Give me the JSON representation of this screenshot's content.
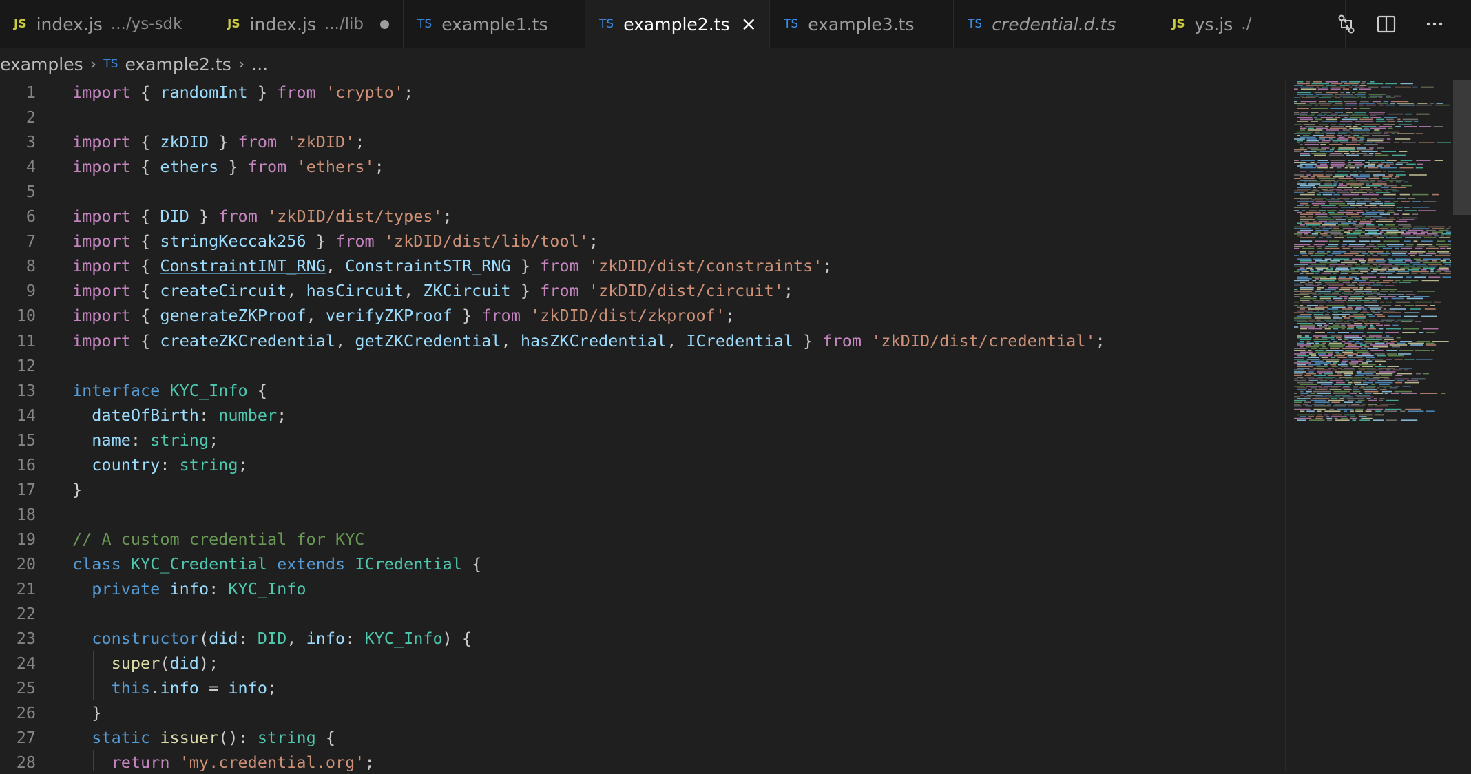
{
  "tabs": [
    {
      "type": "JS",
      "name": "index.js",
      "desc": ".../ys-sdk",
      "active": false,
      "italic": false,
      "modified": false
    },
    {
      "type": "JS",
      "name": "index.js",
      "desc": ".../lib",
      "active": false,
      "italic": false,
      "modified": true
    },
    {
      "type": "TS",
      "name": "example1.ts",
      "desc": "",
      "active": false,
      "italic": false,
      "modified": false
    },
    {
      "type": "TS",
      "name": "example2.ts",
      "desc": "",
      "active": true,
      "italic": false,
      "modified": false
    },
    {
      "type": "TS",
      "name": "example3.ts",
      "desc": "",
      "active": false,
      "italic": false,
      "modified": false
    },
    {
      "type": "TS",
      "name": "credential.d.ts",
      "desc": "",
      "active": false,
      "italic": true,
      "modified": false
    },
    {
      "type": "JS",
      "name": "ys.js",
      "desc": "./",
      "active": false,
      "italic": false,
      "modified": false
    }
  ],
  "tab_actions": [
    "compare-changes-icon",
    "split-editor-icon",
    "more-actions-icon"
  ],
  "breadcrumb": {
    "folder": "examples",
    "file_type": "TS",
    "file": "example2.ts",
    "more": "..."
  },
  "code_lines": [
    {
      "n": "1",
      "t": [
        [
          "k",
          "import"
        ],
        [
          "p",
          " { "
        ],
        [
          "v",
          "randomInt"
        ],
        [
          "p",
          " } "
        ],
        [
          "k",
          "from"
        ],
        [
          "p",
          " "
        ],
        [
          "s",
          "'crypto'"
        ],
        [
          "p",
          ";"
        ]
      ]
    },
    {
      "n": "2",
      "t": []
    },
    {
      "n": "3",
      "t": [
        [
          "k",
          "import"
        ],
        [
          "p",
          " { "
        ],
        [
          "v",
          "zkDID"
        ],
        [
          "p",
          " } "
        ],
        [
          "k",
          "from"
        ],
        [
          "p",
          " "
        ],
        [
          "s",
          "'zkDID'"
        ],
        [
          "p",
          ";"
        ]
      ]
    },
    {
      "n": "4",
      "t": [
        [
          "k",
          "import"
        ],
        [
          "p",
          " { "
        ],
        [
          "v",
          "ethers"
        ],
        [
          "p",
          " } "
        ],
        [
          "k",
          "from"
        ],
        [
          "p",
          " "
        ],
        [
          "s",
          "'ethers'"
        ],
        [
          "p",
          ";"
        ]
      ]
    },
    {
      "n": "5",
      "t": []
    },
    {
      "n": "6",
      "t": [
        [
          "k",
          "import"
        ],
        [
          "p",
          " { "
        ],
        [
          "v",
          "DID"
        ],
        [
          "p",
          " } "
        ],
        [
          "k",
          "from"
        ],
        [
          "p",
          " "
        ],
        [
          "s",
          "'zkDID/dist/types'"
        ],
        [
          "p",
          ";"
        ]
      ]
    },
    {
      "n": "7",
      "t": [
        [
          "k",
          "import"
        ],
        [
          "p",
          " { "
        ],
        [
          "v",
          "stringKeccak256"
        ],
        [
          "p",
          " } "
        ],
        [
          "k",
          "from"
        ],
        [
          "p",
          " "
        ],
        [
          "s",
          "'zkDID/dist/lib/tool'"
        ],
        [
          "p",
          ";"
        ]
      ]
    },
    {
      "n": "8",
      "t": [
        [
          "k",
          "import"
        ],
        [
          "p",
          " { "
        ],
        [
          "v",
          "ConstraintINT_RNG"
        ],
        [
          "p",
          ", "
        ],
        [
          "v",
          "ConstraintSTR_RNG"
        ],
        [
          "p",
          " } "
        ],
        [
          "k",
          "from"
        ],
        [
          "p",
          " "
        ],
        [
          "s",
          "'zkDID/dist/constraints'"
        ],
        [
          "p",
          ";"
        ]
      ]
    },
    {
      "n": "9",
      "t": [
        [
          "k",
          "import"
        ],
        [
          "p",
          " { "
        ],
        [
          "v",
          "createCircuit"
        ],
        [
          "p",
          ", "
        ],
        [
          "v",
          "hasCircuit"
        ],
        [
          "p",
          ", "
        ],
        [
          "v",
          "ZKCircuit"
        ],
        [
          "p",
          " } "
        ],
        [
          "k",
          "from"
        ],
        [
          "p",
          " "
        ],
        [
          "s",
          "'zkDID/dist/circuit'"
        ],
        [
          "p",
          ";"
        ]
      ]
    },
    {
      "n": "10",
      "t": [
        [
          "k",
          "import"
        ],
        [
          "p",
          " { "
        ],
        [
          "v",
          "generateZKProof"
        ],
        [
          "p",
          ", "
        ],
        [
          "v",
          "verifyZKProof"
        ],
        [
          "p",
          " } "
        ],
        [
          "k",
          "from"
        ],
        [
          "p",
          " "
        ],
        [
          "s",
          "'zkDID/dist/zkproof'"
        ],
        [
          "p",
          ";"
        ]
      ]
    },
    {
      "n": "11",
      "t": [
        [
          "k",
          "import"
        ],
        [
          "p",
          " { "
        ],
        [
          "v",
          "createZKCredential"
        ],
        [
          "p",
          ", "
        ],
        [
          "v",
          "getZKCredential"
        ],
        [
          "p",
          ", "
        ],
        [
          "v",
          "hasZKCredential"
        ],
        [
          "p",
          ", "
        ],
        [
          "v",
          "ICredential"
        ],
        [
          "p",
          " } "
        ],
        [
          "k",
          "from"
        ],
        [
          "p",
          " "
        ],
        [
          "s",
          "'zkDID/dist/credential'"
        ],
        [
          "p",
          ";"
        ]
      ]
    },
    {
      "n": "12",
      "t": []
    },
    {
      "n": "13",
      "t": [
        [
          "b",
          "interface"
        ],
        [
          "p",
          " "
        ],
        [
          "t",
          "KYC_Info"
        ],
        [
          "p",
          " {"
        ]
      ]
    },
    {
      "n": "14",
      "t": [
        [
          "p",
          "  "
        ],
        [
          "v",
          "dateOfBirth"
        ],
        [
          "p",
          ": "
        ],
        [
          "t",
          "number"
        ],
        [
          "p",
          ";"
        ]
      ]
    },
    {
      "n": "15",
      "t": [
        [
          "p",
          "  "
        ],
        [
          "v",
          "name"
        ],
        [
          "p",
          ": "
        ],
        [
          "t",
          "string"
        ],
        [
          "p",
          ";"
        ]
      ]
    },
    {
      "n": "16",
      "t": [
        [
          "p",
          "  "
        ],
        [
          "v",
          "country"
        ],
        [
          "p",
          ": "
        ],
        [
          "t",
          "string"
        ],
        [
          "p",
          ";"
        ]
      ]
    },
    {
      "n": "17",
      "t": [
        [
          "p",
          "}"
        ]
      ]
    },
    {
      "n": "18",
      "t": []
    },
    {
      "n": "19",
      "t": [
        [
          "c",
          "// A custom credential for KYC"
        ]
      ]
    },
    {
      "n": "20",
      "t": [
        [
          "b",
          "class"
        ],
        [
          "p",
          " "
        ],
        [
          "t",
          "KYC_Credential"
        ],
        [
          "p",
          " "
        ],
        [
          "b",
          "extends"
        ],
        [
          "p",
          " "
        ],
        [
          "t",
          "ICredential"
        ],
        [
          "p",
          " {"
        ]
      ]
    },
    {
      "n": "21",
      "t": [
        [
          "p",
          "  "
        ],
        [
          "b",
          "private"
        ],
        [
          "p",
          " "
        ],
        [
          "v",
          "info"
        ],
        [
          "p",
          ": "
        ],
        [
          "t",
          "KYC_Info"
        ]
      ]
    },
    {
      "n": "22",
      "t": []
    },
    {
      "n": "23",
      "t": [
        [
          "p",
          "  "
        ],
        [
          "b",
          "constructor"
        ],
        [
          "p",
          "("
        ],
        [
          "v",
          "did"
        ],
        [
          "p",
          ": "
        ],
        [
          "t",
          "DID"
        ],
        [
          "p",
          ", "
        ],
        [
          "v",
          "info"
        ],
        [
          "p",
          ": "
        ],
        [
          "t",
          "KYC_Info"
        ],
        [
          "p",
          ") {"
        ]
      ]
    },
    {
      "n": "24",
      "t": [
        [
          "p",
          "    "
        ],
        [
          "f",
          "super"
        ],
        [
          "p",
          "("
        ],
        [
          "v",
          "did"
        ],
        [
          "p",
          ");"
        ]
      ]
    },
    {
      "n": "25",
      "t": [
        [
          "p",
          "    "
        ],
        [
          "b",
          "this"
        ],
        [
          "p",
          "."
        ],
        [
          "v",
          "info"
        ],
        [
          "p",
          " = "
        ],
        [
          "v",
          "info"
        ],
        [
          "p",
          ";"
        ]
      ]
    },
    {
      "n": "26",
      "t": [
        [
          "p",
          "  }"
        ]
      ]
    },
    {
      "n": "27",
      "t": [
        [
          "p",
          "  "
        ],
        [
          "b",
          "static"
        ],
        [
          "p",
          " "
        ],
        [
          "f",
          "issuer"
        ],
        [
          "p",
          "(): "
        ],
        [
          "t",
          "string"
        ],
        [
          "p",
          " {"
        ]
      ]
    },
    {
      "n": "28",
      "t": [
        [
          "p",
          "    "
        ],
        [
          "k",
          "return"
        ],
        [
          "p",
          " "
        ],
        [
          "s",
          "'my.credential.org'"
        ],
        [
          "p",
          ";"
        ]
      ]
    }
  ],
  "colors": {
    "background": "#1f1f1f",
    "tab_bar": "#181818",
    "keyword": "#c586c0",
    "storage": "#569cd6",
    "string": "#ce9178",
    "variable": "#9cdcfe",
    "type": "#4ec9b0",
    "function": "#dcdcaa",
    "comment": "#6a9955"
  }
}
